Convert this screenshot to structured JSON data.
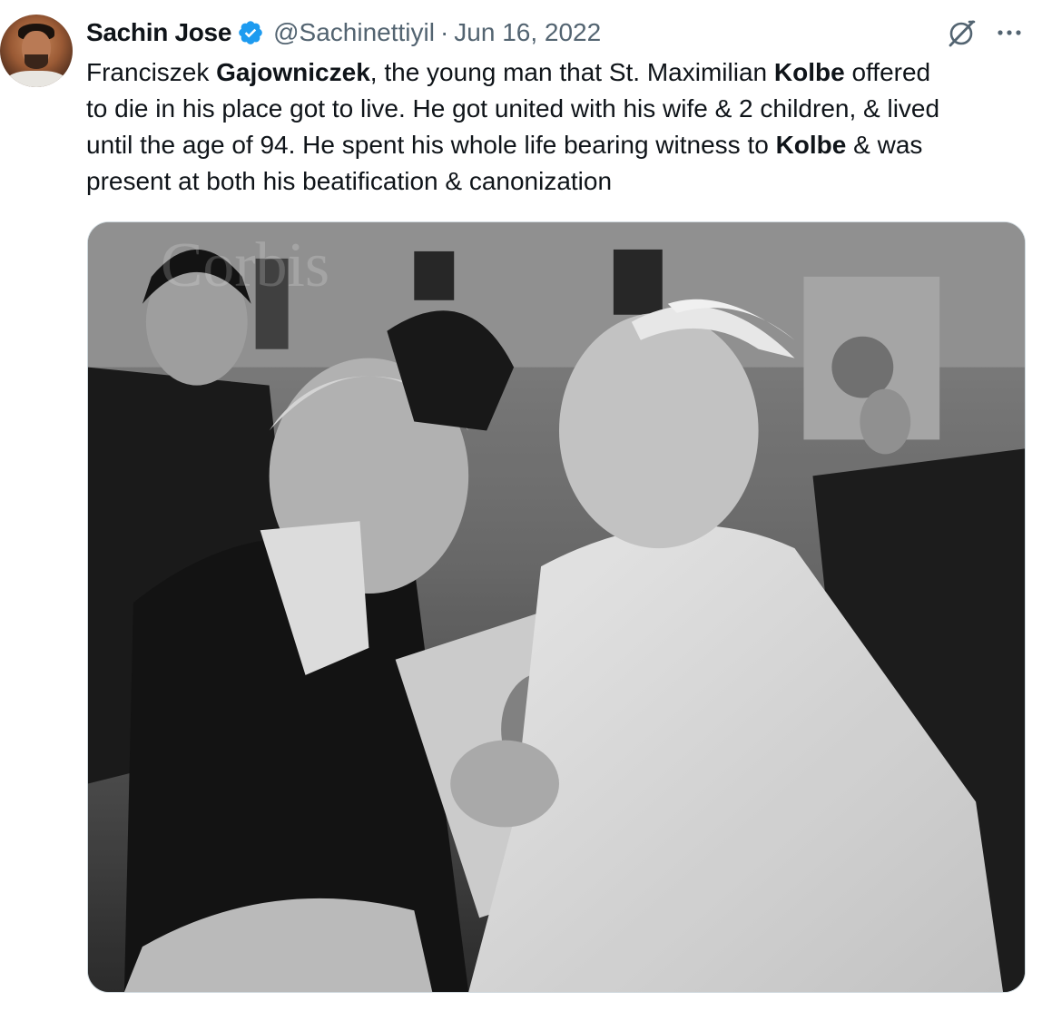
{
  "author": {
    "name": "Sachin Jose",
    "handle": "@Sachinettiyil",
    "separator": "·",
    "date": "Jun 16, 2022",
    "verified": true,
    "avatar_icon": "profile-photo"
  },
  "toolbar": {
    "grok_icon": "grok-icon",
    "more_icon": "more-icon"
  },
  "tweet": {
    "lines": [
      [
        {
          "text": "Franciszek ",
          "bold": false
        },
        {
          "text": "Gajowniczek",
          "bold": true
        },
        {
          "text": ", the young man that St. Maximilian ",
          "bold": false
        },
        {
          "text": "Kolbe",
          "bold": true
        },
        {
          "text": " offered",
          "bold": false
        }
      ],
      [
        {
          "text": "to die in his place got to live. He got united with his wife & 2 children, & lived",
          "bold": false
        }
      ],
      [
        {
          "text": "until the age of 94. He spent his whole life bearing witness to ",
          "bold": false
        },
        {
          "text": "Kolbe",
          "bold": true
        },
        {
          "text": " & was",
          "bold": false
        }
      ],
      [
        {
          "text": "present at both his beatification & canonization",
          "bold": false
        }
      ]
    ]
  },
  "media": {
    "type": "black-and-white photo",
    "watermark": "Corbis"
  },
  "colors": {
    "text_primary": "#0f1419",
    "text_secondary": "#536471",
    "verified_blue": "#1d9bf0",
    "media_border": "#cfd9de"
  }
}
